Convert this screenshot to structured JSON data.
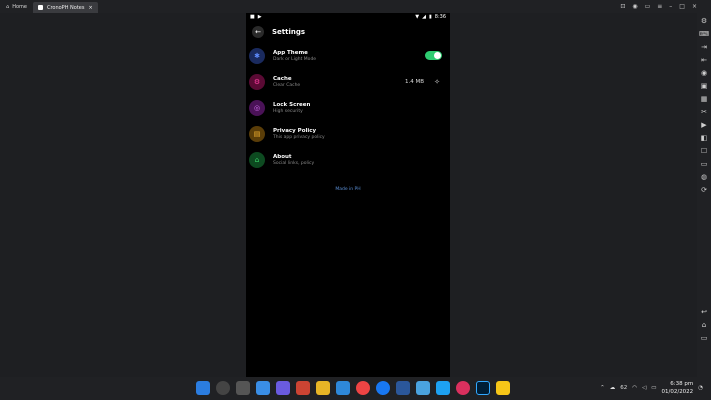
{
  "window": {
    "home_tab": "Home",
    "app_tab": "CronoPH Notes",
    "tab_close": "×"
  },
  "status_bar": {
    "time": "8:36"
  },
  "settings": {
    "title": "Settings",
    "items": [
      {
        "title": "App Theme",
        "subtitle": "Dark or Light Mode",
        "icon": "bluetooth-icon",
        "color": "#2f5bd6"
      },
      {
        "title": "Cache",
        "subtitle": "Clear Cache",
        "icon": "cache-icon",
        "color": "#e0198a",
        "value": "1.4 MB"
      },
      {
        "title": "Lock Screen",
        "subtitle": "High security",
        "icon": "fingerprint-icon",
        "color": "#b23bd1"
      },
      {
        "title": "Privacy Policy",
        "subtitle": "This app privacy policy",
        "icon": "policy-icon",
        "color": "#e3a21a"
      },
      {
        "title": "About",
        "subtitle": "Social links, policy",
        "icon": "about-icon",
        "color": "#1fb24a"
      }
    ],
    "footer": "Made in PH",
    "theme_toggle_on": true
  },
  "taskbar": {
    "temp": "62",
    "time": "6:38 pm",
    "date": "01/02/2022"
  }
}
